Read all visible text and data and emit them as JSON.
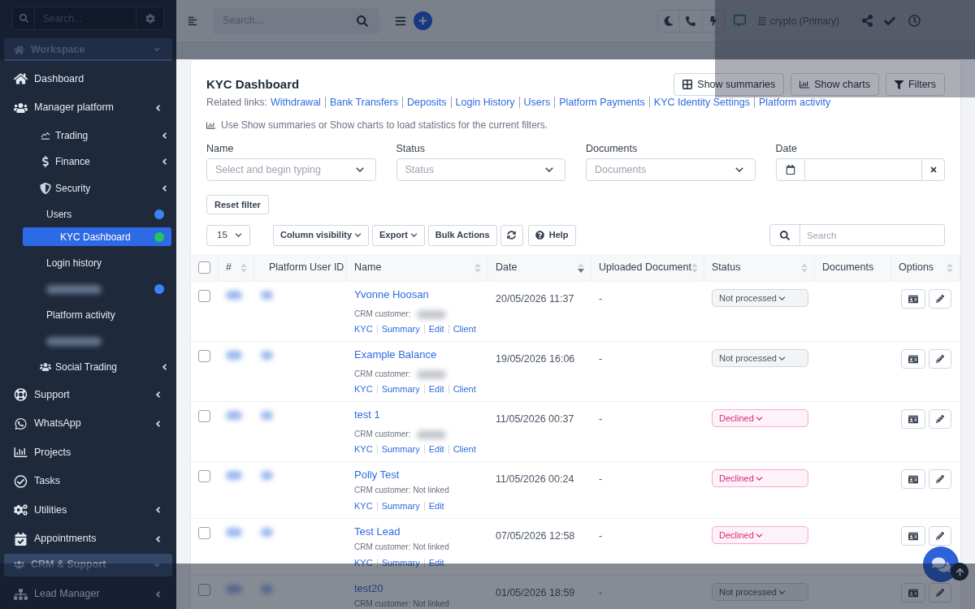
{
  "sidebar": {
    "search": {
      "placeholder": "Search..."
    },
    "items": [
      {
        "kind": "section",
        "label": "Workspace"
      },
      {
        "kind": "link",
        "label": "Dashboard",
        "selected": false,
        "has_submenu": false
      },
      {
        "kind": "link",
        "label": "Manager platform",
        "selected": false,
        "has_submenu": true,
        "children": [
          {
            "kind": "link",
            "label": "Trading",
            "selected": false,
            "has_submenu": true
          },
          {
            "kind": "link",
            "label": "Finance",
            "selected": false,
            "has_submenu": true
          },
          {
            "kind": "link",
            "label": "Security",
            "selected": false,
            "has_submenu": true,
            "children": [
              {
                "kind": "link",
                "label": "Users",
                "selected": false,
                "has_submenu": false,
                "color": "#3b82f6"
              },
              {
                "kind": "link",
                "label": "KYC Dashboard",
                "selected": true,
                "has_submenu": false,
                "color": "#22c55e"
              },
              {
                "kind": "link",
                "label": "Login history",
                "selected": false,
                "has_submenu": false
              },
              {
                "kind": "redacted",
                "color": "#3b82f6"
              },
              {
                "kind": "link",
                "label": "Platform activity",
                "selected": false,
                "has_submenu": false
              },
              {
                "kind": "redacted"
              }
            ]
          },
          {
            "kind": "link",
            "label": "Social Trading",
            "selected": false,
            "has_submenu": true
          }
        ]
      },
      {
        "kind": "link",
        "label": "Support",
        "selected": false,
        "has_submenu": true
      },
      {
        "kind": "link",
        "label": "WhatsApp",
        "selected": false,
        "has_submenu": true
      },
      {
        "kind": "link",
        "label": "Projects",
        "selected": false,
        "has_submenu": false
      },
      {
        "kind": "link",
        "label": "Tasks",
        "selected": false,
        "has_submenu": false
      },
      {
        "kind": "link",
        "label": "Utilities",
        "selected": false,
        "has_submenu": true
      },
      {
        "kind": "link",
        "label": "Appointments",
        "selected": false,
        "has_submenu": true
      },
      {
        "kind": "section",
        "label": "CRM & Support"
      },
      {
        "kind": "link",
        "label": "Lead Manager",
        "selected": false,
        "has_submenu": true
      }
    ]
  },
  "topbar": {
    "search": {
      "placeholder": "Search..."
    },
    "account": {
      "label": "crypto (Primary)"
    }
  },
  "main": {
    "title": "KYC Dashboard",
    "actions": [
      {
        "label": "Show summaries"
      },
      {
        "label": "Show charts"
      },
      {
        "label": "Filters"
      }
    ],
    "related_links": {
      "label": "Related links:",
      "links": [
        "Withdrawal",
        "Bank Transfers",
        "Deposits",
        "Login History",
        "Users",
        "Platform Payments",
        "KYC Identity Settings",
        "Platform activity"
      ]
    },
    "hint": "Use Show summaries or Show charts to load statistics for the current filters.",
    "filters": [
      {
        "kind": "select",
        "label": "Name",
        "placeholder": "Select and begin typing"
      },
      {
        "kind": "select",
        "label": "Status",
        "placeholder": "Status"
      },
      {
        "kind": "select",
        "label": "Documents",
        "placeholder": "Documents"
      },
      {
        "kind": "date",
        "label": "Date"
      }
    ],
    "reset_button": "Reset filter",
    "toolbar": {
      "page_size": "15",
      "buttons": [
        {
          "kind": "dropdown",
          "label": "Column visibility"
        },
        {
          "kind": "dropdown",
          "label": "Export"
        },
        {
          "kind": "plain",
          "label": "Bulk Actions"
        },
        {
          "kind": "refresh"
        },
        {
          "kind": "help",
          "label": "Help"
        }
      ],
      "search": {
        "placeholder": "Search"
      }
    },
    "table": {
      "select_all": {
        "checked": false
      },
      "columns": [
        {
          "label": "#",
          "sortable": true,
          "sorted": false
        },
        {
          "label": "Platform User ID",
          "sortable": false
        },
        {
          "label": "Name",
          "sortable": true,
          "sorted": false
        },
        {
          "label": "Date",
          "sortable": true,
          "sorted": true
        },
        {
          "label": "Uploaded Document",
          "sortable": true,
          "sorted": false
        },
        {
          "label": "Status",
          "sortable": true,
          "sorted": false
        },
        {
          "label": "Documents",
          "sortable": false
        },
        {
          "label": "Options",
          "sortable": true,
          "sorted": false
        }
      ],
      "rows": [
        {
          "checked": false,
          "name": "Yvonne Hoosan",
          "crm_label": "CRM customer:",
          "crm_redacted": true,
          "links": [
            "KYC",
            "Summary",
            "Edit",
            "Client"
          ],
          "date": "20/05/2026 11:37",
          "uploaded_document": "-",
          "status": {
            "kind": "neutral",
            "label": "Not processed"
          }
        },
        {
          "checked": false,
          "name": "Example Balance",
          "crm_label": "CRM customer:",
          "crm_redacted": true,
          "links": [
            "KYC",
            "Summary",
            "Edit",
            "Client"
          ],
          "date": "19/05/2026 16:06",
          "uploaded_document": "-",
          "status": {
            "kind": "neutral",
            "label": "Not processed"
          }
        },
        {
          "checked": false,
          "name": "test 1",
          "crm_label": "CRM customer:",
          "crm_redacted": true,
          "links": [
            "KYC",
            "Summary",
            "Edit",
            "Client"
          ],
          "date": "11/05/2026 00:37",
          "uploaded_document": "-",
          "status": {
            "kind": "declined",
            "label": "Declined"
          }
        },
        {
          "checked": false,
          "name": "Polly Test",
          "crm_label": "CRM customer:",
          "crm_redacted": false,
          "crm_value": "Not linked",
          "links": [
            "KYC",
            "Summary",
            "Edit"
          ],
          "date": "11/05/2026 00:24",
          "uploaded_document": "-",
          "status": {
            "kind": "declined",
            "label": "Declined"
          }
        },
        {
          "checked": false,
          "name": "Test Lead",
          "crm_label": "CRM customer:",
          "crm_redacted": false,
          "crm_value": "Not linked",
          "links": [
            "KYC",
            "Summary",
            "Edit"
          ],
          "date": "07/05/2026 12:58",
          "uploaded_document": "-",
          "status": {
            "kind": "declined",
            "label": "Declined"
          }
        },
        {
          "checked": false,
          "name": "test20",
          "crm_label": "CRM customer:",
          "crm_redacted": false,
          "crm_value": "Not linked",
          "date": "01/05/2026 18:59",
          "uploaded_document": "-",
          "status": {
            "kind": "neutral",
            "label": "Not processed"
          }
        }
      ]
    }
  }
}
